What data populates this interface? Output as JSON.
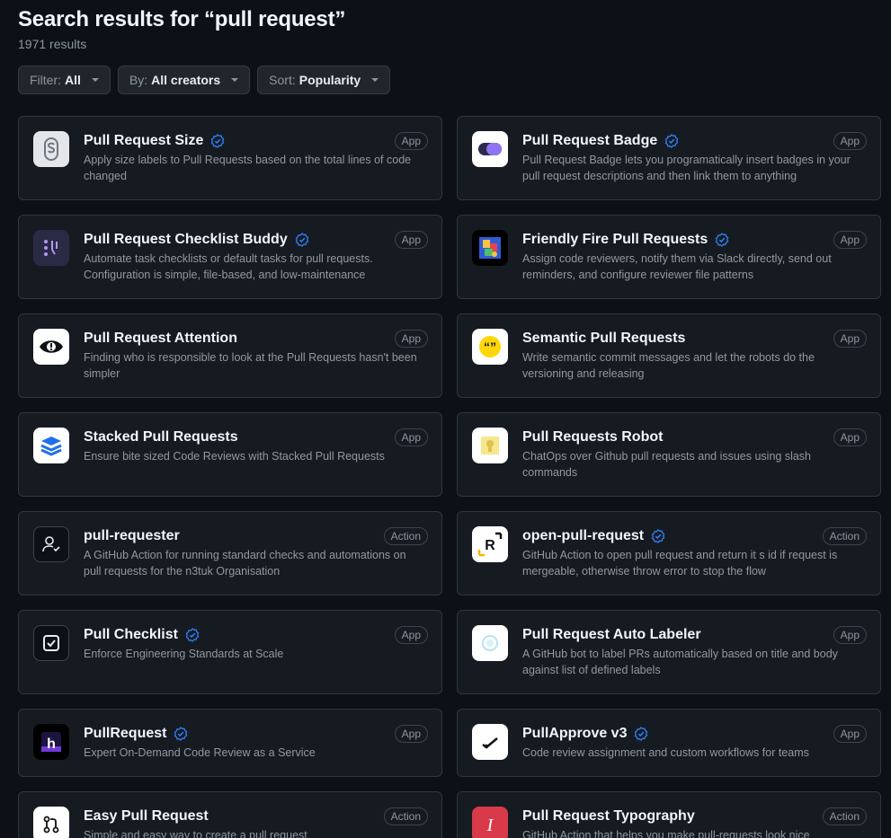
{
  "header": {
    "title": "Search results for “pull request”",
    "count": "1971 results"
  },
  "filters": [
    {
      "label": "Filter:",
      "value": "All"
    },
    {
      "label": "By:",
      "value": "All creators"
    },
    {
      "label": "Sort:",
      "value": "Popularity"
    }
  ],
  "colors": {
    "verified": "#2f81f7",
    "background": "#0d1117",
    "card": "#161b22"
  },
  "results": [
    {
      "name": "Pull Request Size",
      "verified": true,
      "type": "App",
      "description": "Apply size labels to Pull Requests based on the total lines of code changed",
      "icon": "size-s-icon"
    },
    {
      "name": "Pull Request Badge",
      "verified": true,
      "type": "App",
      "description": "Pull Request Badge lets you programatically insert badges in your pull request descriptions and then link them to anything",
      "icon": "badge-pill-icon"
    },
    {
      "name": "Pull Request Checklist Buddy",
      "verified": true,
      "type": "App",
      "description": "Automate task checklists or default tasks for pull requests. Configuration is simple, file-based, and low-maintenance",
      "icon": "checklist-buddy-icon"
    },
    {
      "name": "Friendly Fire Pull Requests",
      "verified": true,
      "type": "App",
      "description": "Assign code reviewers, notify them via Slack directly, send out reminders, and configure reviewer file patterns",
      "icon": "friendly-fire-icon"
    },
    {
      "name": "Pull Request Attention",
      "verified": false,
      "type": "App",
      "description": "Finding who is responsible to look at the Pull Requests hasn't been simpler",
      "icon": "eye-icon"
    },
    {
      "name": "Semantic Pull Requests",
      "verified": false,
      "type": "App",
      "description": "Write semantic commit messages and let the robots do the versioning and releasing",
      "icon": "quote-bubble-icon"
    },
    {
      "name": "Stacked Pull Requests",
      "verified": false,
      "type": "App",
      "description": "Ensure bite sized Code Reviews with Stacked Pull Requests",
      "icon": "stack-layers-icon"
    },
    {
      "name": "Pull Requests Robot",
      "verified": false,
      "type": "App",
      "description": "ChatOps over Github pull requests and issues using slash commands",
      "icon": "robot-icon"
    },
    {
      "name": "pull-requester",
      "verified": false,
      "type": "Action",
      "description": "A GitHub Action for running standard checks and automations on pull requests for the n3tuk Organisation",
      "icon": "person-check-icon"
    },
    {
      "name": "open-pull-request",
      "verified": true,
      "type": "Action",
      "description": "GitHub Action to open pull request and return it s id if request is mergeable, otherwise throw error to stop the flow",
      "icon": "r-letter-icon",
      "iconText": "R"
    },
    {
      "name": "Pull Checklist",
      "verified": true,
      "type": "App",
      "description": "Enforce Engineering Standards at Scale",
      "icon": "checkbox-icon"
    },
    {
      "name": "Pull Request Auto Labeler",
      "verified": false,
      "type": "App",
      "description": "A GitHub bot to label PRs automatically based on title and body against list of defined labels",
      "icon": "label-circle-icon"
    },
    {
      "name": "PullRequest",
      "verified": true,
      "type": "App",
      "description": "Expert On-Demand Code Review as a Service",
      "icon": "h-logo-icon",
      "iconText": "h"
    },
    {
      "name": "PullApprove v3",
      "verified": true,
      "type": "App",
      "description": "Code review assignment and custom workflows for teams",
      "icon": "approve-check-icon"
    },
    {
      "name": "Easy Pull Request",
      "verified": false,
      "type": "Action",
      "description": "Simple and easy way to create a pull request",
      "icon": "git-pull-request-icon"
    },
    {
      "name": "Pull Request Typography",
      "verified": false,
      "type": "Action",
      "description": "GitHub Action that helps you make pull-requests look nice",
      "icon": "italic-i-icon",
      "iconText": "I"
    }
  ]
}
